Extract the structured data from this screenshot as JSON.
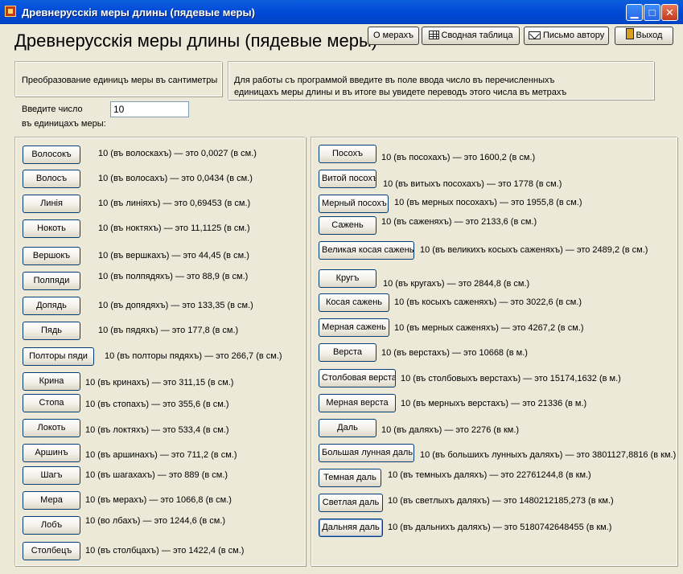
{
  "window": {
    "title": "Древнерусскія меры длины (пядевые меры)",
    "min_glyph": "▁",
    "max_glyph": "□",
    "close_glyph": "✕"
  },
  "header": {
    "title": "Древнерусскія меры длины (пядевые меры)"
  },
  "toolbar": {
    "about_label": "О мерахъ",
    "table_label": "Сводная таблица",
    "letter_label": "Письмо автору",
    "exit_label": "Выход"
  },
  "info": {
    "left_text": "Преобразование единицъ меры въ сантиметры",
    "right_line1": "Для работы съ программой введите въ поле ввода число въ перечисленныхъ",
    "right_line2": "единицахъ меры длины и въ итоге вы увидете  переводъ этого числа въ метрахъ"
  },
  "input": {
    "label_line1": "Введите число",
    "label_line2": "въ единицахъ меры:",
    "value": "10"
  },
  "left_units": [
    {
      "label": "Волосокъ",
      "result": "10 (въ волоскахъ) — это 0,0027 (в см.)"
    },
    {
      "label": "Волосъ",
      "result": "10 (въ волосахъ) — это 0,0434 (в см.)"
    },
    {
      "label": "Линія",
      "result": "10 (въ линіяхъ) — это 0,69453 (в см.)"
    },
    {
      "label": "Нокоть",
      "result": "10 (въ ноктяхъ) — это 11,1125 (в см.)"
    },
    {
      "label": "Вершокъ",
      "result": "10 (въ вершкахъ) — это 44,45 (в см.)"
    },
    {
      "label": "Полпяди",
      "result": "10 (въ полпядяхъ) — это 88,9 (в см.)"
    },
    {
      "label": "Допядь",
      "result": "10 (въ допядяхъ) — это 133,35 (в см.)"
    },
    {
      "label": "Пядь",
      "result": "10 (въ пядяхъ) — это 177,8 (в см.)"
    },
    {
      "label": "Полторы пяди",
      "result": "10 (въ полторы пядяхъ) — это 266,7 (в см.)"
    },
    {
      "label": "Крина",
      "result": "10 (въ кринахъ) — это 311,15 (в см.)"
    },
    {
      "label": "Стопа",
      "result": "10 (въ стопахъ) — это 355,6 (в см.)"
    },
    {
      "label": "Локоть",
      "result": "10 (въ локтяхъ) — это 533,4 (в см.)"
    },
    {
      "label": "Аршинъ",
      "result": "10 (въ аршинахъ) — это 711,2 (в см.)"
    },
    {
      "label": "Шагъ",
      "result": "10 (въ шагахахъ) — это 889 (в см.)"
    },
    {
      "label": "Мера",
      "result": "10 (въ мерахъ) — это 1066,8 (в см.)"
    },
    {
      "label": "Лобъ",
      "result": "10 (во лбахъ) — это 1244,6 (в см.)"
    },
    {
      "label": "Столбецъ",
      "result": "10 (въ столбцахъ) — это 1422,4 (в см.)"
    }
  ],
  "right_units": [
    {
      "label": "Посохъ",
      "result": "10 (въ посохахъ) — это 1600,2 (в см.)"
    },
    {
      "label": "Витой посохъ",
      "result": "10 (въ витыхъ посохахъ) — это 1778 (в см.)"
    },
    {
      "label": "Мерный посохъ",
      "result": "10 (въ мерных посохахъ) — это 1955,8 (в см.)"
    },
    {
      "label": "Сажень",
      "result": "10 (въ саженяхъ) — это 2133,6 (в см.)"
    },
    {
      "label": "Великая косая сажень",
      "result": "10 (въ великихъ косыхъ саженяхъ) — это 2489,2 (в см.)"
    },
    {
      "label": "Кругъ",
      "result": "10 (въ кругахъ) — это 2844,8 (в см.)"
    },
    {
      "label": "Косая сажень",
      "result": "10 (въ косыхъ саженяхъ) — это 3022,6 (в см.)"
    },
    {
      "label": "Мерная сажень",
      "result": "10 (въ мерных саженяхъ) — это 4267,2 (в см.)"
    },
    {
      "label": "Верста",
      "result": "10 (въ верстахъ) — это 10668 (в м.)"
    },
    {
      "label": "Столбовая верста",
      "result": "10 (въ столбовыхъ верстахъ) — это 15174,1632 (в м.)"
    },
    {
      "label": "Мерная верста",
      "result": "10 (въ мерныхъ верстахъ) — это 21336 (в м.)"
    },
    {
      "label": "Даль",
      "result": "10 (въ даляхъ) — это 2276 (в км.)"
    },
    {
      "label": "Большая лунная даль",
      "result": "10 (въ большихъ лунныхъ даляхъ) — это 3801127,8816 (в км.)"
    },
    {
      "label": "Темная даль",
      "result": "10 (въ темныхъ даляхъ) — это 22761244,8 (в км.)"
    },
    {
      "label": "Светлая даль",
      "result": "10 (въ светлыхъ даляхъ) — это 1480212185,273 (в км.)"
    },
    {
      "label": "Дальняя даль",
      "result": "10 (въ дальнихъ даляхъ) — это 5180742648455 (в км.)"
    }
  ]
}
